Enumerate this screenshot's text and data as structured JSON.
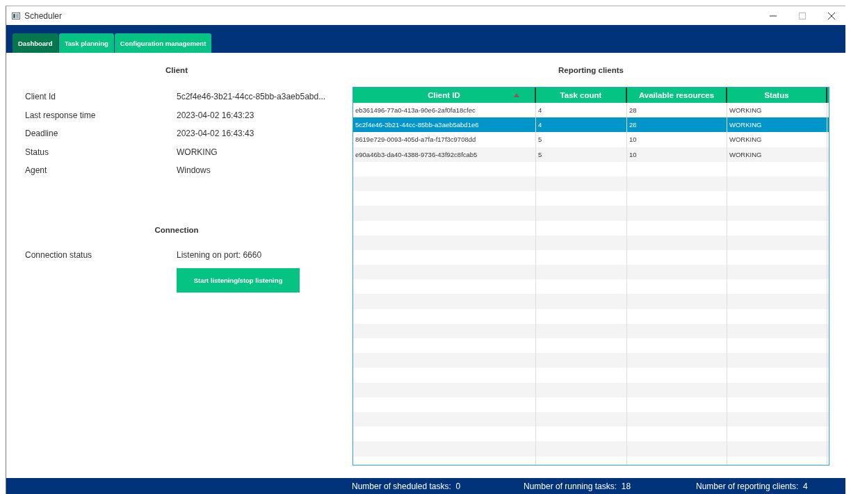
{
  "window": {
    "title": "Scheduler"
  },
  "tabs": [
    {
      "label": "Dashboard",
      "selected": true
    },
    {
      "label": "Task planning",
      "selected": false
    },
    {
      "label": "Configuration management",
      "selected": false
    }
  ],
  "client": {
    "heading": "Client",
    "fields": [
      {
        "label": "Client Id",
        "value": "5c2f4e46-3b21-44cc-85bb-a3aeb5abd..."
      },
      {
        "label": "Last response time",
        "value": "2023-04-02 16:43:23"
      },
      {
        "label": "Deadline",
        "value": "2023-04-02 16:43:43"
      },
      {
        "label": "Status",
        "value": "WORKING"
      },
      {
        "label": "Agent",
        "value": "Windows"
      }
    ]
  },
  "connection": {
    "heading": "Connection",
    "label": "Connection status",
    "value": "Listening on port: 6660",
    "button": "Start listening/stop listening"
  },
  "table": {
    "heading": "Reporting clients",
    "columns": [
      {
        "label": "Client ID",
        "sorted": true
      },
      {
        "label": "Task count",
        "sorted": false
      },
      {
        "label": "Available resources",
        "sorted": false
      },
      {
        "label": "Status",
        "sorted": false
      }
    ],
    "rows": [
      {
        "cells": [
          "eb361496-77a0-413a-90e6-2af0fa18cfec",
          "4",
          "28",
          "WORKING"
        ],
        "selected": false
      },
      {
        "cells": [
          "5c2f4e46-3b21-44cc-85bb-a3aeb5abd1e6",
          "4",
          "28",
          "WORKING"
        ],
        "selected": true
      },
      {
        "cells": [
          "8619e729-0093-405d-a7fa-f17f3c9708dd",
          "5",
          "10",
          "WORKING"
        ],
        "selected": false
      },
      {
        "cells": [
          "e90a46b3-da40-4388-9736-43f92c8fcab5",
          "5",
          "10",
          "WORKING"
        ],
        "selected": false
      }
    ]
  },
  "status_bar": [
    {
      "label": "Number of sheduled tasks:",
      "value": "0"
    },
    {
      "label": "Number of running tasks:",
      "value": "18"
    },
    {
      "label": "Number of reporting clients:",
      "value": "4"
    }
  ]
}
